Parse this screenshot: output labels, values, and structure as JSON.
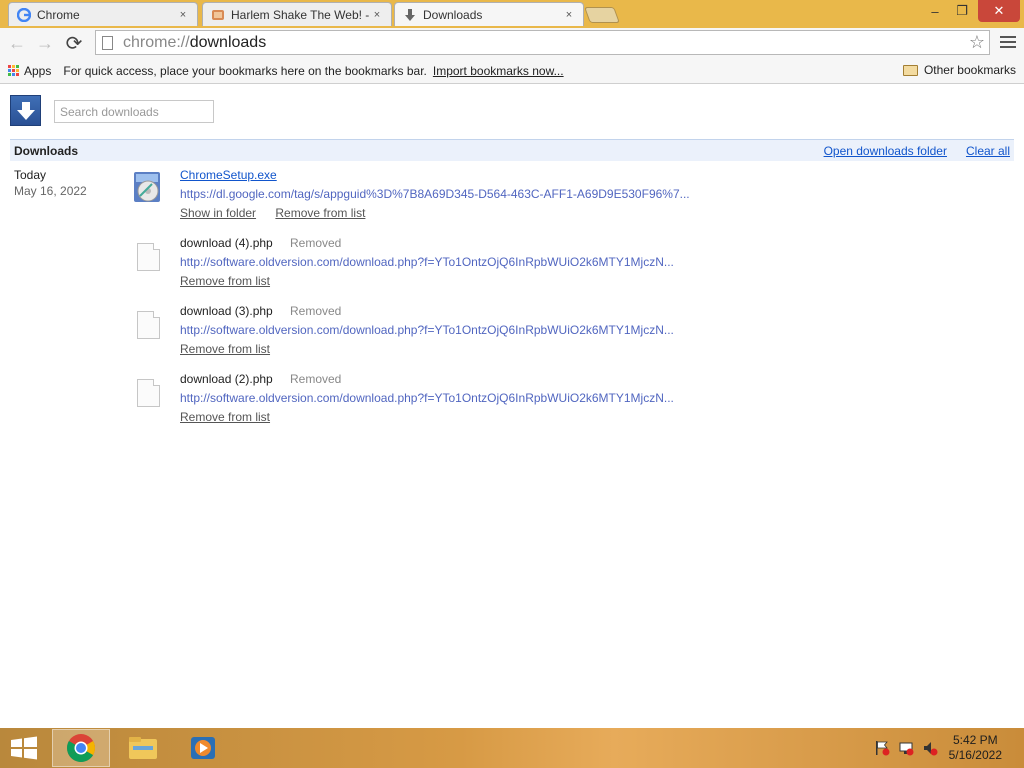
{
  "tabs": [
    {
      "title": "Chrome",
      "close": "×",
      "icon": "google-g-icon"
    },
    {
      "title": "Harlem Shake The Web! -",
      "close": "×",
      "icon": "harlem-shake-favicon"
    },
    {
      "title": "Downloads",
      "close": "×",
      "icon": "download-arrow-icon"
    }
  ],
  "window_controls": {
    "minimize": "–",
    "restore": "❐",
    "close": "✕"
  },
  "toolbar": {
    "back": "←",
    "forward": "→",
    "reload": "⟳",
    "url_scheme": "chrome://",
    "url_path": "downloads",
    "star": "☆"
  },
  "bookmarks": {
    "apps_label": "Apps",
    "hint_text": "For quick access, place your bookmarks here on the bookmarks bar.",
    "import_link": "Import bookmarks now...",
    "other_label": "Other bookmarks"
  },
  "downloads_page": {
    "search_placeholder": "Search downloads",
    "header_title": "Downloads",
    "open_folder_link": "Open downloads folder",
    "clear_all_link": "Clear all",
    "group": {
      "day": "Today",
      "date": "May 16, 2022"
    },
    "entries": [
      {
        "name": "ChromeSetup.exe",
        "status": "",
        "url": "https://dl.google.com/tag/s/appguid%3D%7B8A69D345-D564-463C-AFF1-A69D9E530F96%7...",
        "actions": [
          "Show in folder",
          "Remove from list"
        ]
      },
      {
        "name": "download (4).php",
        "status": "Removed",
        "url": "http://software.oldversion.com/download.php?f=YTo1OntzOjQ6InRpbWUiO2k6MTY1MjczN...",
        "actions": [
          "Remove from list"
        ]
      },
      {
        "name": "download (3).php",
        "status": "Removed",
        "url": "http://software.oldversion.com/download.php?f=YTo1OntzOjQ6InRpbWUiO2k6MTY1MjczN...",
        "actions": [
          "Remove from list"
        ]
      },
      {
        "name": "download (2).php",
        "status": "Removed",
        "url": "http://software.oldversion.com/download.php?f=YTo1OntzOjQ6InRpbWUiO2k6MTY1MjczN...",
        "actions": [
          "Remove from list"
        ]
      }
    ]
  },
  "taskbar": {
    "clock_time": "5:42 PM",
    "clock_date": "5/16/2022",
    "pinned": [
      "windows-start-icon",
      "chrome-icon",
      "file-explorer-icon",
      "media-player-icon"
    ],
    "tray": [
      "action-center-flag-icon",
      "network-icon",
      "volume-muted-icon"
    ]
  },
  "colors": {
    "titlebar": "#e9b84a",
    "link": "#1155cc",
    "taskbar": "#d79a45",
    "close_button": "#c9473a"
  }
}
